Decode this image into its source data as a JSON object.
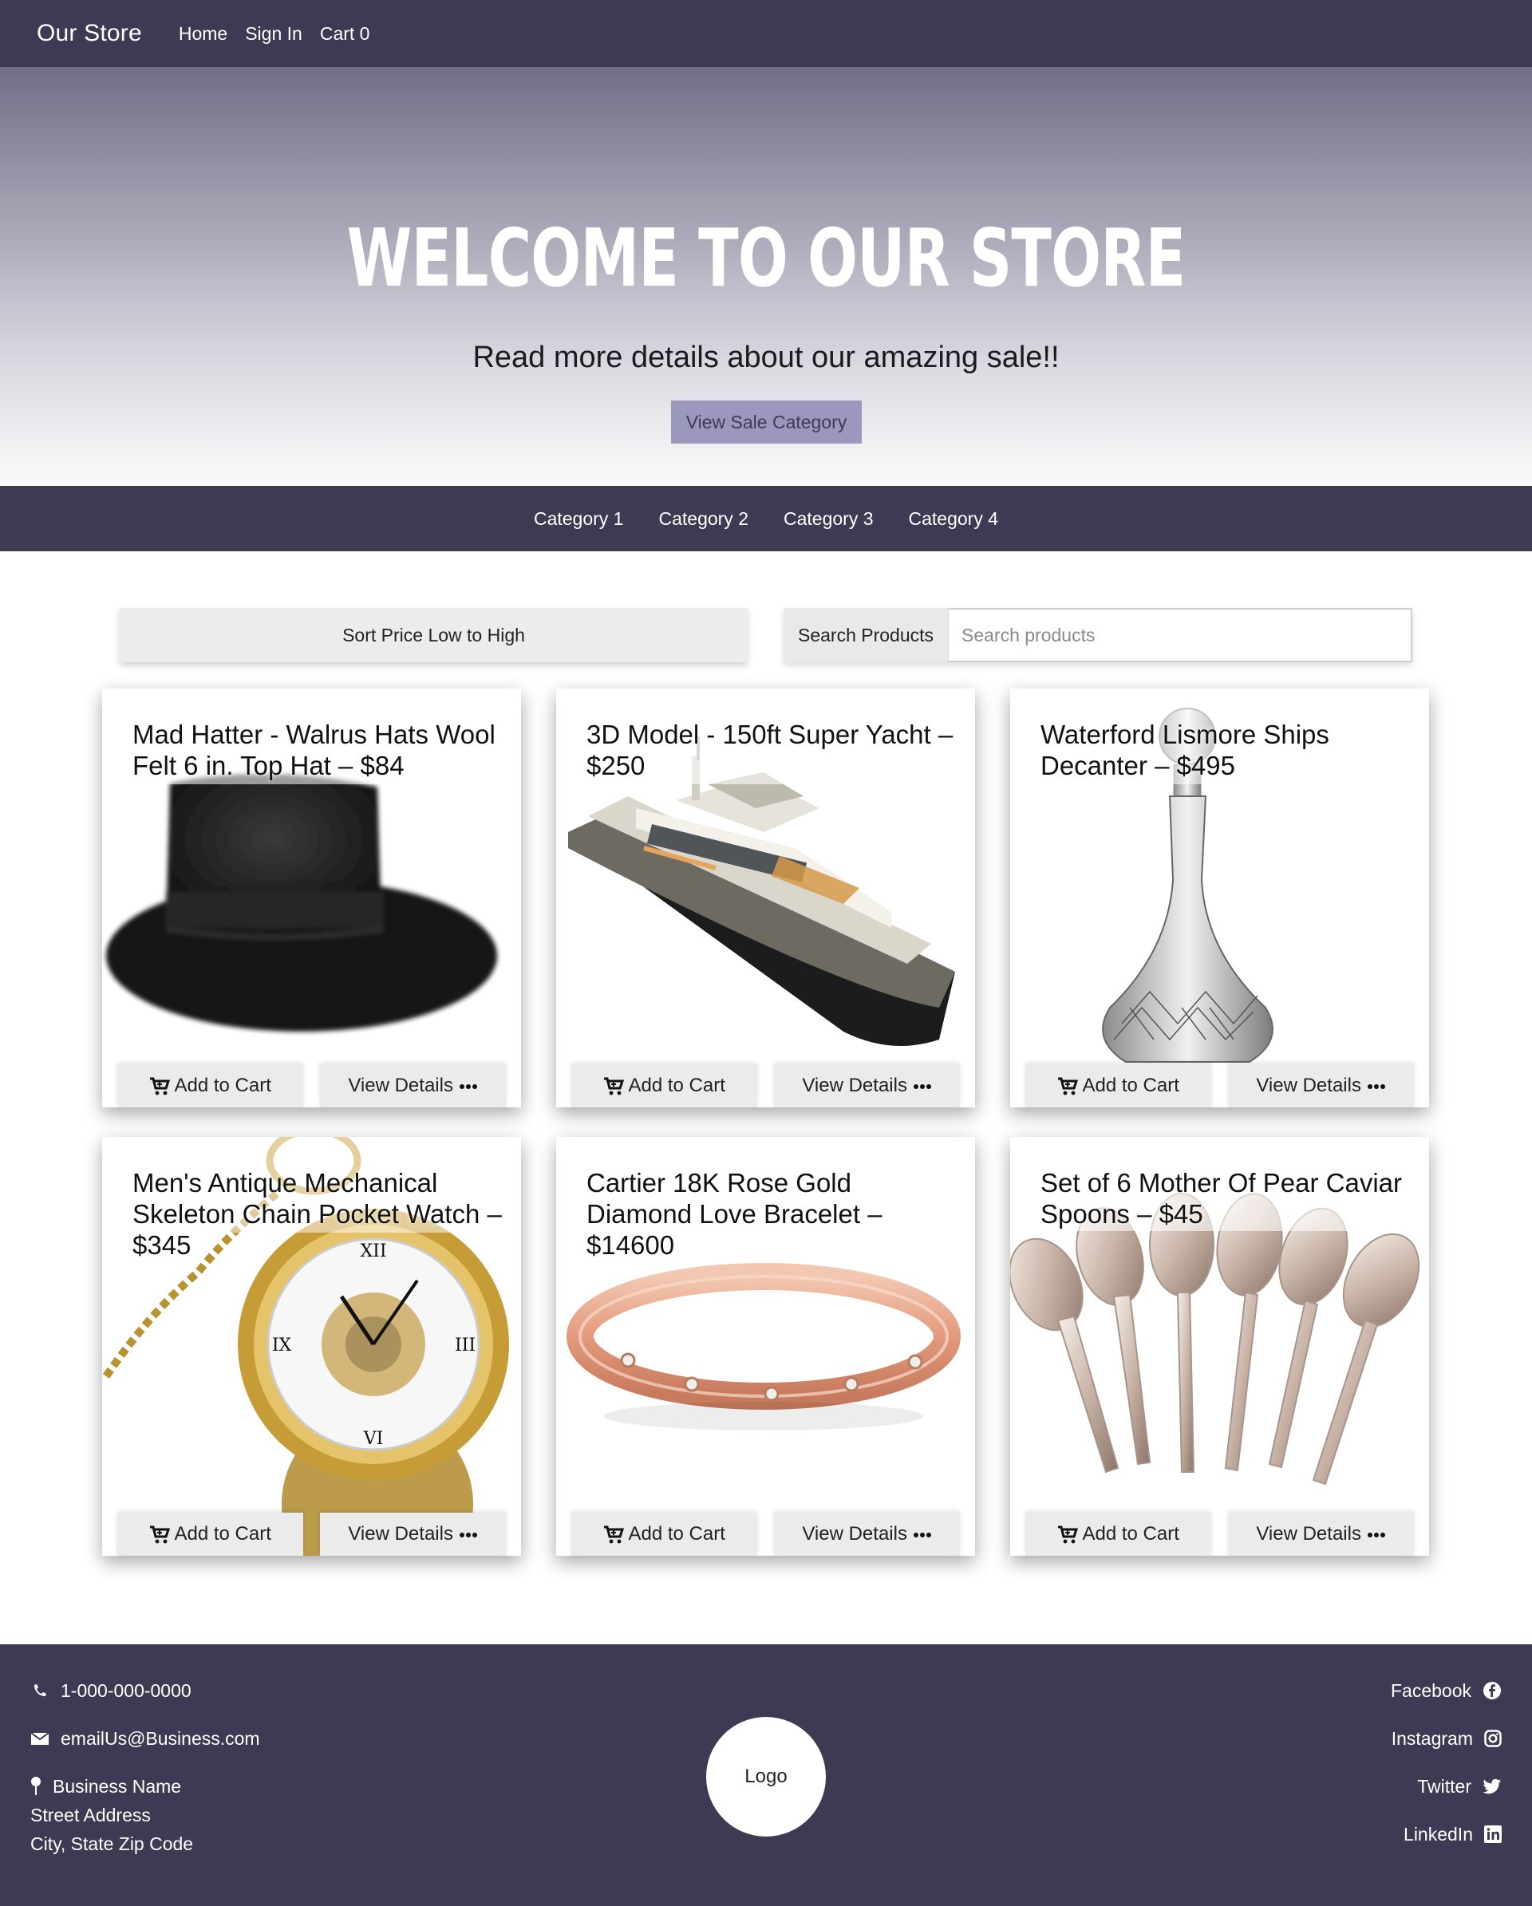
{
  "nav": {
    "brand": "Our Store",
    "links": [
      "Home",
      "Sign In",
      "Cart 0"
    ]
  },
  "hero": {
    "title": "WELCOME TO OUR STORE",
    "subtitle": "Read more details about our amazing sale!!",
    "button": "View Sale Category"
  },
  "categories": [
    "Category 1",
    "Category 2",
    "Category 3",
    "Category 4"
  ],
  "controls": {
    "sort_label": "Sort Price Low to High",
    "search_label": "Search Products",
    "search_placeholder": "Search products",
    "search_value": ""
  },
  "products": [
    {
      "title": "Mad Hatter - Walrus Hats Wool Felt 6 in. Top Hat – $84",
      "image": "top-hat-image"
    },
    {
      "title": "3D Model - 150ft Super Yacht – $250",
      "image": "yacht-image"
    },
    {
      "title": "Waterford Lismore Ships Decanter – $495",
      "image": "decanter-image"
    },
    {
      "title": "Men's Antique Mechanical Skeleton Chain Pocket Watch – $345",
      "image": "pocket-watch-image"
    },
    {
      "title": "Cartier 18K Rose Gold Diamond Love Bracelet – $14600",
      "image": "bracelet-image"
    },
    {
      "title": "Set of 6 Mother Of Pear Caviar Spoons – $45",
      "image": "spoons-image"
    }
  ],
  "card_actions": {
    "add_to_cart": "Add to Cart",
    "view_details": "View Details"
  },
  "footer": {
    "phone": "1-000-000-0000",
    "email": "emailUs@Business.com",
    "address": [
      "Business Name",
      "Street Address",
      "City, State Zip Code"
    ],
    "logo": "Logo",
    "social": [
      "Facebook",
      "Instagram",
      "Twitter",
      "LinkedIn"
    ]
  },
  "colors": {
    "nav_bg": "#3e3a53",
    "accent_button": "#9c97bc",
    "button_gray": "#ebebeb"
  }
}
